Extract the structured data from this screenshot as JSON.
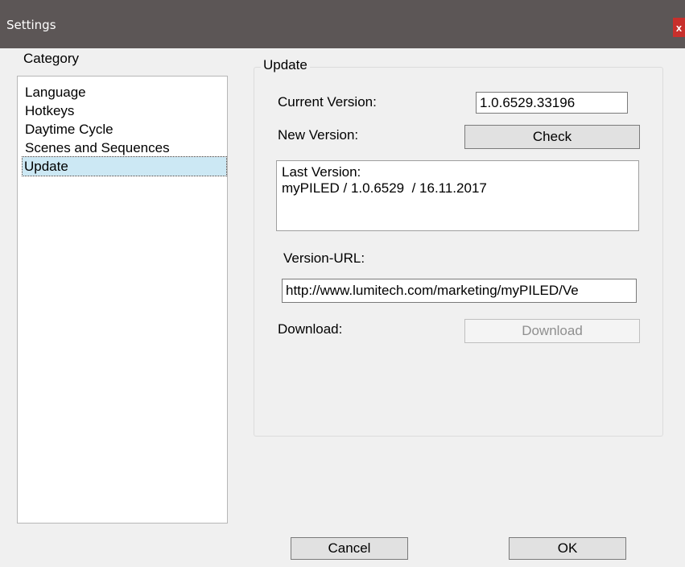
{
  "window": {
    "title": "Settings",
    "close_label": "x"
  },
  "category": {
    "label": "Category",
    "items": [
      {
        "label": "Language"
      },
      {
        "label": "Hotkeys"
      },
      {
        "label": "Daytime Cycle"
      },
      {
        "label": "Scenes and Sequences"
      },
      {
        "label": "Update"
      }
    ],
    "selected": "Update"
  },
  "update": {
    "group_title": "Update",
    "current_version_label": "Current Version:",
    "current_version_value": "1.0.6529.33196",
    "new_version_label": "New Version:",
    "check_button": "Check",
    "last_version_line1": "Last Version:",
    "last_version_line2": "myPILED / 1.0.6529  / 16.11.2017",
    "version_url_label": "Version-URL:",
    "version_url_value": "http://www.lumitech.com/marketing/myPILED/Ve",
    "download_label": "Download:",
    "download_button": "Download"
  },
  "footer": {
    "cancel_button": "Cancel",
    "ok_button": "OK"
  },
  "colors": {
    "titlebar": "#5c5656",
    "close": "#c8302c",
    "selection": "#cce8f4",
    "background": "#f0f0f0"
  }
}
